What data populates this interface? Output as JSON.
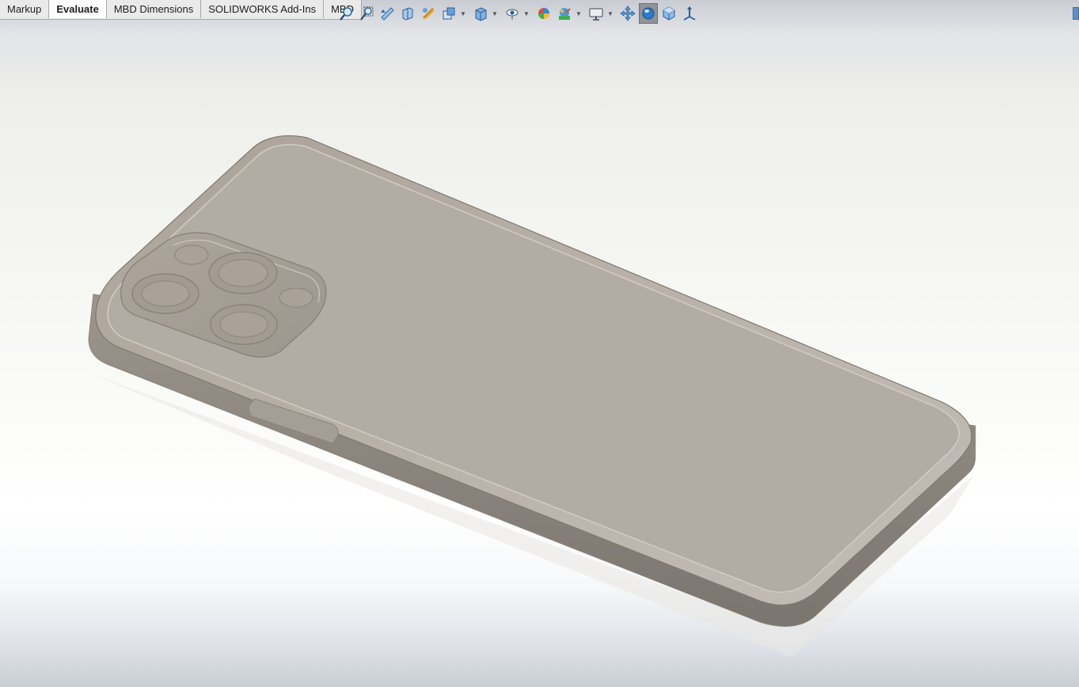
{
  "command_tabs": [
    {
      "label": "Markup",
      "active": false
    },
    {
      "label": "Evaluate",
      "active": true
    },
    {
      "label": "MBD Dimensions",
      "active": false
    },
    {
      "label": "SOLIDWORKS Add-Ins",
      "active": false
    },
    {
      "label": "MBD",
      "active": false
    }
  ],
  "view_toolbar": [
    {
      "icon": "zoom-to-fit-icon"
    },
    {
      "icon": "zoom-to-area-icon"
    },
    {
      "icon": "previous-view-icon"
    },
    {
      "icon": "section-view-icon"
    },
    {
      "icon": "dynamic-annotation-views-icon"
    },
    {
      "icon": "view-orientation-icon",
      "dropdown": true
    },
    {
      "icon": "display-style-icon",
      "dropdown": true
    },
    {
      "icon": "hide-show-items-icon",
      "dropdown": true
    },
    {
      "icon": "edit-appearance-icon"
    },
    {
      "icon": "apply-scene-icon",
      "dropdown": true
    },
    {
      "icon": "view-settings-icon",
      "dropdown": true
    },
    {
      "icon": "pan-icon"
    },
    {
      "icon": "realview-graphics-icon",
      "active": true
    },
    {
      "icon": "isometric-view-icon"
    },
    {
      "icon": "triad-icon"
    }
  ],
  "colors": {
    "model_body": "#b4aca3",
    "model_edge": "#8e877f",
    "background_top": "#c9ccd2",
    "background_bottom": "#c8cdd4",
    "toolbar_blue": "#3a7fc4"
  }
}
